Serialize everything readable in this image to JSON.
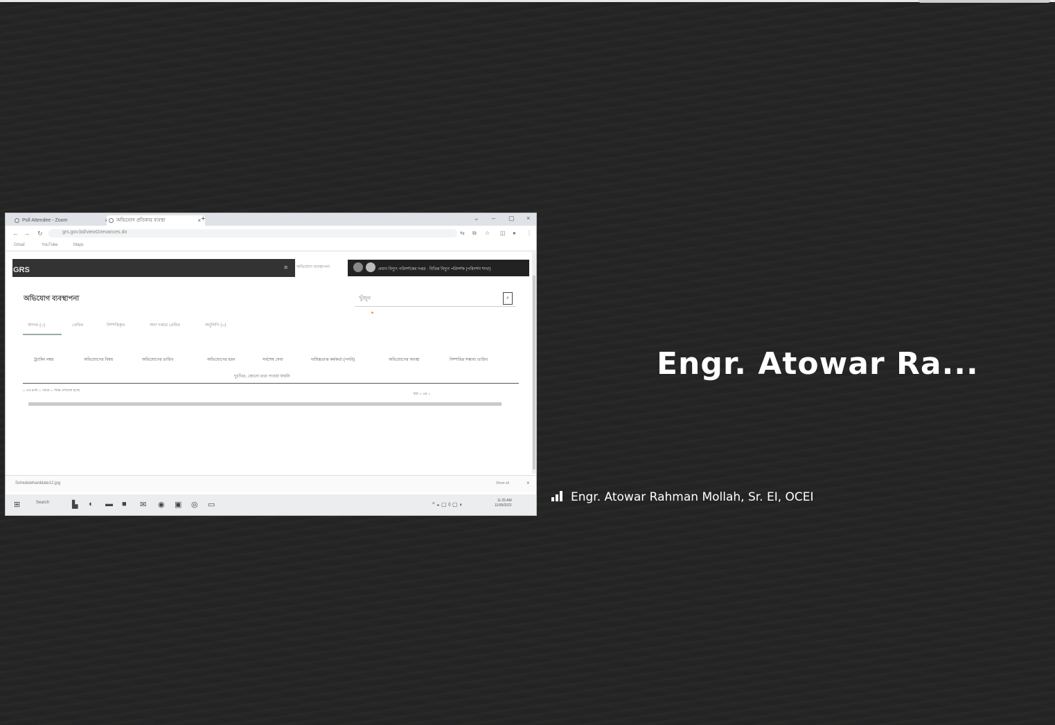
{
  "participant": {
    "display_name_truncated": "Engr. Atowar Ra...",
    "name_label": "Engr. Atowar Rahman Mollah, Sr. EI, OCEI"
  },
  "shared_screen": {
    "tabs": [
      {
        "label": "Poll Attendee - Zoom"
      },
      {
        "label": "অভিযোগ প্রতিকার ব্যবস্থা"
      }
    ],
    "url": "grs.gov.bd/viewGrievances.do",
    "bookmarks": [
      "Gmail",
      "YouTube",
      "Maps"
    ],
    "app": {
      "logo": "GRS",
      "nav_tab": "অভিযোগ ব্যবস্থাপনা",
      "user_text": "প্রধান বিদ্যুৎ পরিদর্শকের দপ্তর · বিভিন্ন বিদ্যুৎ পরিদর্শক (পরিদর্শন শাখা)"
    },
    "page": {
      "title": "অভিযোগ ব্যবস্থাপনা",
      "search_placeholder": "খুঁজুন",
      "filters": [
        "আগত (০)",
        "প্রেরিত",
        "নিষ্পত্তিকৃত",
        "অন্য দপ্তরে প্রেরিত",
        "অনুলিপি (০)"
      ],
      "columns": [
        "ট্র্যাকিং নম্বর",
        "অভিযোগের বিষয়",
        "অভিযোগের তারিখ",
        "অভিযোগের ধরন",
        "সর্বশেষ সেবা",
        "দায়িত্বপ্রাপ্ত কর্মকর্তা (পদবি)",
        "অভিযোগের অবস্থা",
        "নিষ্পত্তির সম্ভাব্য তারিখ"
      ],
      "empty_message": "দুঃখিত, কোনো তথ্য পাওয়া যায়নি",
      "footer_left": "০ এর মধ্যে ০ থেকে ০ পর্যন্ত দেখানো হচ্ছে",
      "footer_right": "পৃষ্ঠা ০ এর ০"
    },
    "download": {
      "file": "Scheduleharddate12.jpg",
      "show_all": "Show all"
    },
    "taskbar": {
      "search": "Search",
      "time": "11:25 AM",
      "date": "11/09/2022"
    }
  }
}
